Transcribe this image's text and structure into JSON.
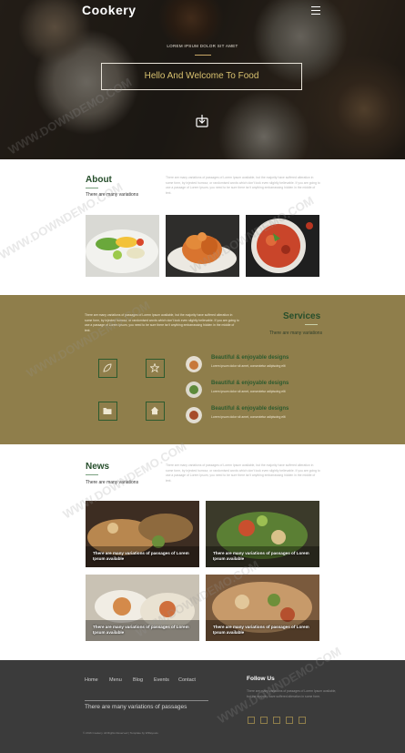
{
  "header": {
    "logo": "Cookery",
    "hero_subtitle": "LOREM IPSUM DOLOR SIT AMET",
    "hero_title": "Hello And Welcome To Food"
  },
  "about": {
    "title": "About",
    "subtitle": "There are many variations",
    "paragraph": "There are many variations of passages of Lorem Ipsum available, but the majority have suffered alteration in some form, by injected humour, or randomised words which don't look even slightly believable. If you are going to use a passage of Lorem Ipsum, you need to be sure there isn't anything embarrassing hidden in the middle of text."
  },
  "services": {
    "title": "Services",
    "subtitle": "There are many variations",
    "paragraph": "There are many variations of passages of Lorem Ipsum available, but the majority have suffered alteration in some form, by injected humour, or randomised words which don't look even slightly believable. If you are going to use a passage of Lorem Ipsum, you need to be sure there isn't anything embarrassing hidden in the middle of text.",
    "items": [
      {
        "title": "Beautiful & enjoyable designs",
        "text": "Lorem ipsum dolor sit amet, consectetur adipiscing elit"
      },
      {
        "title": "Beautiful & enjoyable designs",
        "text": "Lorem ipsum dolor sit amet, consectetur adipiscing elit"
      },
      {
        "title": "Beautiful & enjoyable designs",
        "text": "Lorem ipsum dolor sit amet, consectetur adipiscing elit"
      }
    ]
  },
  "news": {
    "title": "News",
    "subtitle": "There are many variations",
    "paragraph": "There are many variations of passages of Lorem Ipsum available, but the majority have suffered alteration in some form, by injected humour, or randomised words which don't look even slightly believable. If you are going to use a passage of Lorem Ipsum, you need to be sure there isn't anything embarrassing hidden in the middle of text.",
    "cards": [
      {
        "caption": "There are many variations of passages of Lorem Ipsum available"
      },
      {
        "caption": "There are many variations of passages of Lorem Ipsum available"
      },
      {
        "caption": "There are many variations of passages of Lorem Ipsum available"
      },
      {
        "caption": "There are many variations of passages of Lorem Ipsum available"
      }
    ]
  },
  "footer": {
    "nav": [
      "Home",
      "Menu",
      "Blog",
      "Events",
      "Contact"
    ],
    "tagline": "There are many variations of passages",
    "follow_title": "Follow Us",
    "follow_text": "There are many variations of passages of Lorem Ipsum available, but the majority have suffered alteration in some form.",
    "copyright": "© 2016 Cookery. All Rights Reserved | Template by W3layouts"
  },
  "watermark": "WWW.DOWNDEMO.COM",
  "colors": {
    "accent_green": "#264e2b",
    "services_bg": "#8f7e4b",
    "footer_bg": "#3b3b3b",
    "hero_title": "#d8c16f"
  }
}
